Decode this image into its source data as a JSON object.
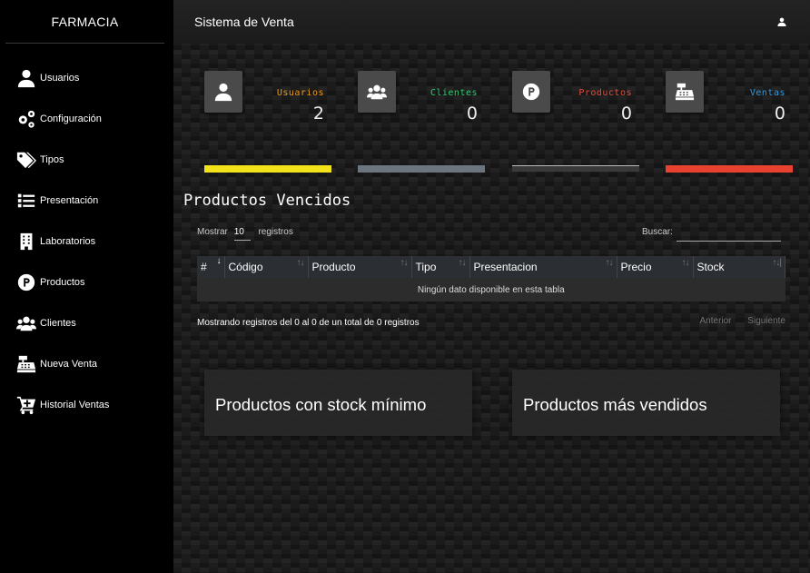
{
  "brand": "FARMACIA",
  "header": {
    "title": "Sistema de Venta",
    "user_icon": "user-icon"
  },
  "sidebar": {
    "items": [
      {
        "label": "Usuarios",
        "icon": "user-icon"
      },
      {
        "label": "Configuración",
        "icon": "gears-icon"
      },
      {
        "label": "Tipos",
        "icon": "tags-icon"
      },
      {
        "label": "Presentación",
        "icon": "list-icon"
      },
      {
        "label": "Laboratorios",
        "icon": "building-icon"
      },
      {
        "label": "Productos",
        "icon": "parking-icon"
      },
      {
        "label": "Clientes",
        "icon": "users-icon"
      },
      {
        "label": "Nueva Venta",
        "icon": "cash-register-icon"
      },
      {
        "label": "Historial Ventas",
        "icon": "cart-plus-icon"
      }
    ]
  },
  "cards": [
    {
      "title": "Usuarios",
      "value": "2",
      "color": "#f39c12",
      "bar": "#f1e21c",
      "icon": "user-icon"
    },
    {
      "title": "Clientes",
      "value": "0",
      "color": "#2ecc71",
      "bar": "#6c757d",
      "icon": "users-icon"
    },
    {
      "title": "Productos",
      "value": "0",
      "color": "#e74c3c",
      "bar": "#3a3a3a",
      "icon": "parking-icon"
    },
    {
      "title": "Ventas",
      "value": "0",
      "color": "#3498db",
      "bar": "#e8412f",
      "icon": "cash-register-icon"
    }
  ],
  "expired": {
    "title": "Productos Vencidos",
    "length_label_pre": "Mostrar",
    "length_value": "10",
    "length_label_post": "registros",
    "search_label": "Buscar:",
    "columns": [
      "#",
      "Código",
      "Producto",
      "Tipo",
      "Presentacion",
      "Precio",
      "Stock"
    ],
    "empty": "Ningún dato disponible en esta tabla",
    "info": "Mostrando registros del 0 al 0 de un total de 0 registros",
    "prev": "Anterior",
    "next": "Siguiente"
  },
  "panels": {
    "low_stock": "Productos con stock mínimo",
    "top_sold": "Productos más vendidos"
  }
}
